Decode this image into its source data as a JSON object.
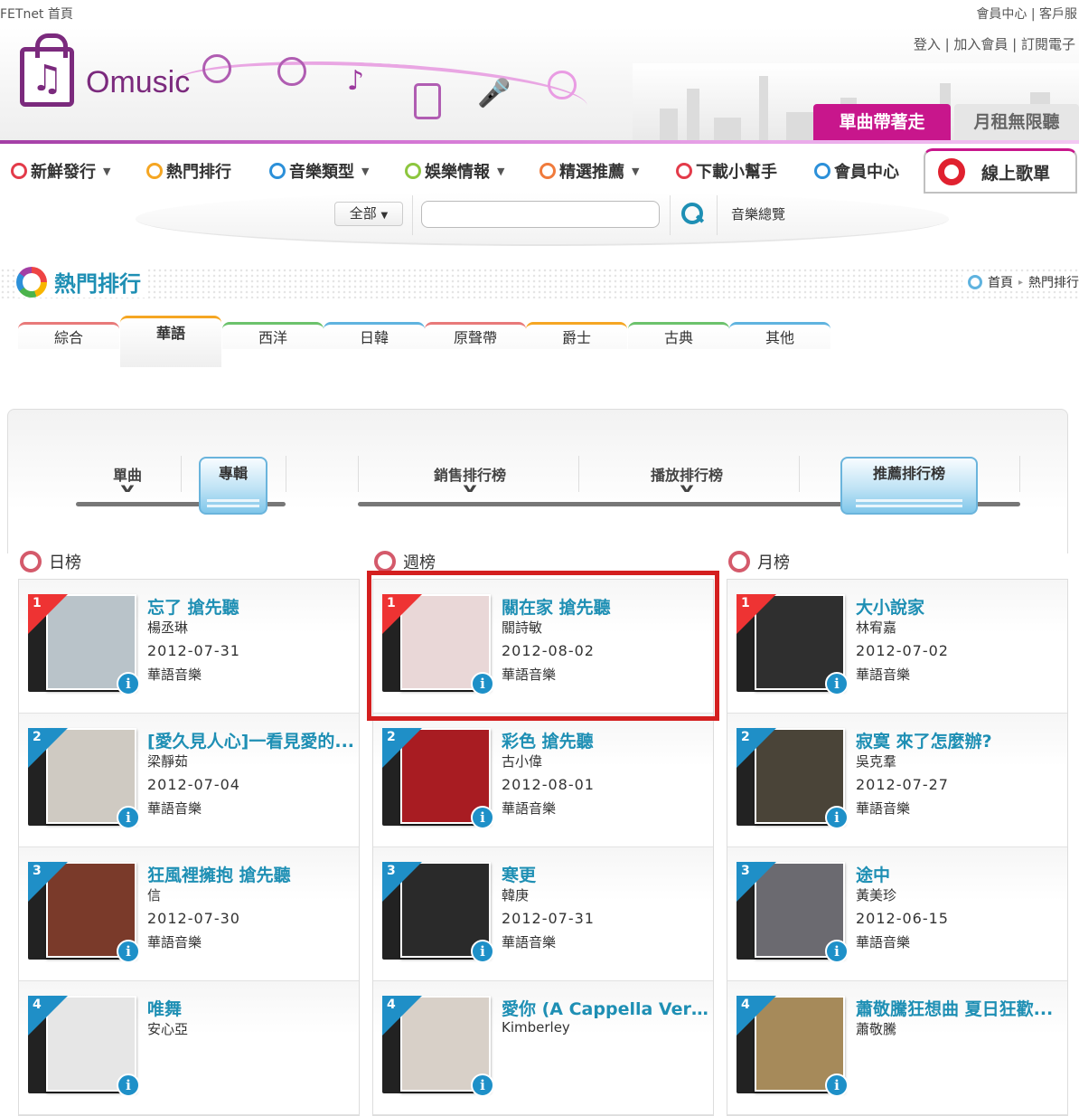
{
  "topbar": {
    "left": "FETnet 首頁",
    "right": "會員中心 | 客戶服"
  },
  "header": {
    "logo_text": "Omusic",
    "login_links": "登入 | 加入會員 | 訂閱電子",
    "tab_single": "單曲帶著走",
    "tab_monthly": "月租無限聽"
  },
  "nav": {
    "items": [
      {
        "label": "新鮮發行",
        "color": "#e33b4a",
        "caret": true
      },
      {
        "label": "熱門排行",
        "color": "#f5a623",
        "caret": false
      },
      {
        "label": "音樂類型",
        "color": "#2c90d9",
        "caret": true
      },
      {
        "label": "娛樂情報",
        "color": "#8dc63f",
        "caret": true
      },
      {
        "label": "精選推薦",
        "color": "#f07b3c",
        "caret": true
      },
      {
        "label": "下載小幫手",
        "color": "#e33b4a",
        "caret": false
      },
      {
        "label": "會員中心",
        "color": "#2c90d9",
        "caret": false
      }
    ],
    "online_label": "線上歌單"
  },
  "search": {
    "select_value": "全部",
    "placeholder": "",
    "browse_all": "音樂總覽"
  },
  "section": {
    "title": "熱門排行",
    "breadcrumb_home": "首頁",
    "breadcrumb_sep": "▸",
    "breadcrumb_current": "熱門排行"
  },
  "genre_tabs": [
    {
      "label": "綜合",
      "color": "#e87979"
    },
    {
      "label": "華語",
      "color": "#f5a623",
      "active": true
    },
    {
      "label": "西洋",
      "color": "#6cc26c"
    },
    {
      "label": "日韓",
      "color": "#5fb3df"
    },
    {
      "label": "原聲帶",
      "color": "#e87979"
    },
    {
      "label": "爵士",
      "color": "#f5a623"
    },
    {
      "label": "古典",
      "color": "#6cc26c"
    },
    {
      "label": "其他",
      "color": "#5fb3df"
    }
  ],
  "panel": {
    "type_single": "單曲",
    "type_album": "專輯",
    "rank_sales": "銷售排行榜",
    "rank_play": "播放排行榜",
    "rank_recommend": "推薦排行榜"
  },
  "columns": [
    {
      "title": "日榜",
      "items": [
        {
          "rank": "1",
          "title": "忘了 搶先聽",
          "artist": "楊丞琳",
          "date": "2012-07-31",
          "genre": "華語音樂",
          "art": "#b9c3c9"
        },
        {
          "rank": "2",
          "title": "[愛久見人心]一看見愛的...",
          "artist": "梁靜茹",
          "date": "2012-07-04",
          "genre": "華語音樂",
          "art": "#cfcac2"
        },
        {
          "rank": "3",
          "title": "狂風裡擁抱 搶先聽",
          "artist": "信",
          "date": "2012-07-30",
          "genre": "華語音樂",
          "art": "#7a3a2a"
        },
        {
          "rank": "4",
          "title": "唯舞",
          "artist": "安心亞",
          "date": "",
          "genre": "",
          "art": "#e6e6e6"
        }
      ]
    },
    {
      "title": "週榜",
      "items": [
        {
          "rank": "1",
          "title": "關在家 搶先聽",
          "artist": "關詩敏",
          "date": "2012-08-02",
          "genre": "華語音樂",
          "art": "#e9d7d7"
        },
        {
          "rank": "2",
          "title": "彩色 搶先聽",
          "artist": "古小偉",
          "date": "2012-08-01",
          "genre": "華語音樂",
          "art": "#a81c22"
        },
        {
          "rank": "3",
          "title": "寒更",
          "artist": "韓庚",
          "date": "2012-07-31",
          "genre": "華語音樂",
          "art": "#2a2a2a"
        },
        {
          "rank": "4",
          "title": "愛你 (A Cappella Vers...",
          "artist": "Kimberley",
          "date": "",
          "genre": "",
          "art": "#d8d0c8"
        }
      ]
    },
    {
      "title": "月榜",
      "items": [
        {
          "rank": "1",
          "title": "大小說家",
          "artist": "林宥嘉",
          "date": "2012-07-02",
          "genre": "華語音樂",
          "art": "#2f2f2f"
        },
        {
          "rank": "2",
          "title": "寂寞 來了怎麼辦?",
          "artist": "吳克羣",
          "date": "2012-07-27",
          "genre": "華語音樂",
          "art": "#4a4438"
        },
        {
          "rank": "3",
          "title": "途中",
          "artist": "黃美珍",
          "date": "2012-06-15",
          "genre": "華語音樂",
          "art": "#6b6a70"
        },
        {
          "rank": "4",
          "title": "蕭敬騰狂想曲 夏日狂歡...",
          "artist": "蕭敬騰",
          "date": "",
          "genre": "",
          "art": "#a68a5a"
        }
      ]
    }
  ]
}
